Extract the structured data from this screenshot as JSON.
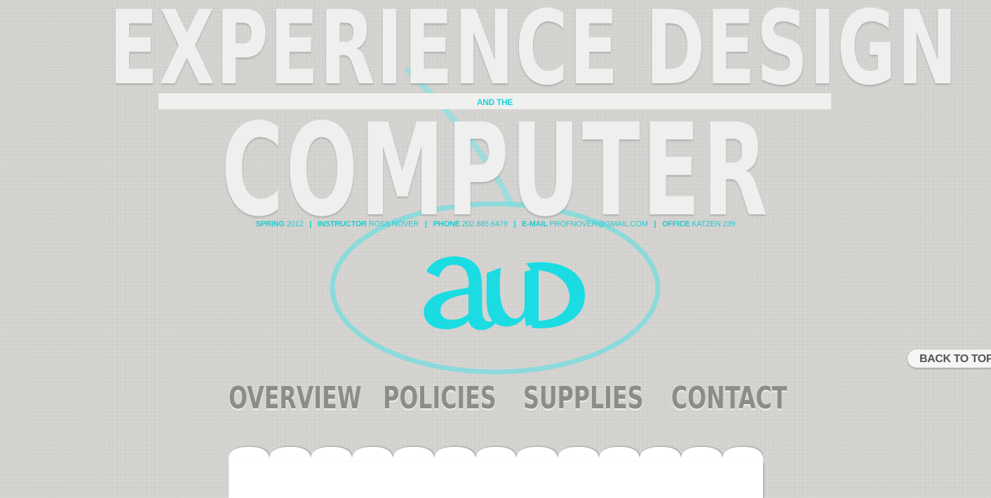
{
  "header": {
    "title_top": "EXPERIENCE DESIGN",
    "title_connector": "AND THE",
    "title_bottom": "COMPUTER"
  },
  "course_info": {
    "term_label": "SPRING",
    "term_value": "2012",
    "instructor_label": "INSTRUCTOR",
    "instructor_value": "ROSS NOVER",
    "phone_label": "PHONE",
    "phone_value": "202.885.6479",
    "email_label": "E-MAIL",
    "email_value": "PROFNOVER@GMAIL.COM",
    "office_label": "OFFICE",
    "office_value": "KATZEN 239",
    "separator": "|"
  },
  "logo": {
    "text": "au D",
    "icon": "au-logo-icon"
  },
  "nav": {
    "items": [
      {
        "label": "OVERVIEW"
      },
      {
        "label": "POLICIES"
      },
      {
        "label": "SUPPLIES"
      },
      {
        "label": "CONTACT"
      }
    ]
  },
  "back_to_top": {
    "label": "BACK TO TOP"
  },
  "colors": {
    "accent": "#1dd3d9",
    "background": "#d3d2cf",
    "title": "#efefef",
    "nav": "#8d8c8a"
  }
}
